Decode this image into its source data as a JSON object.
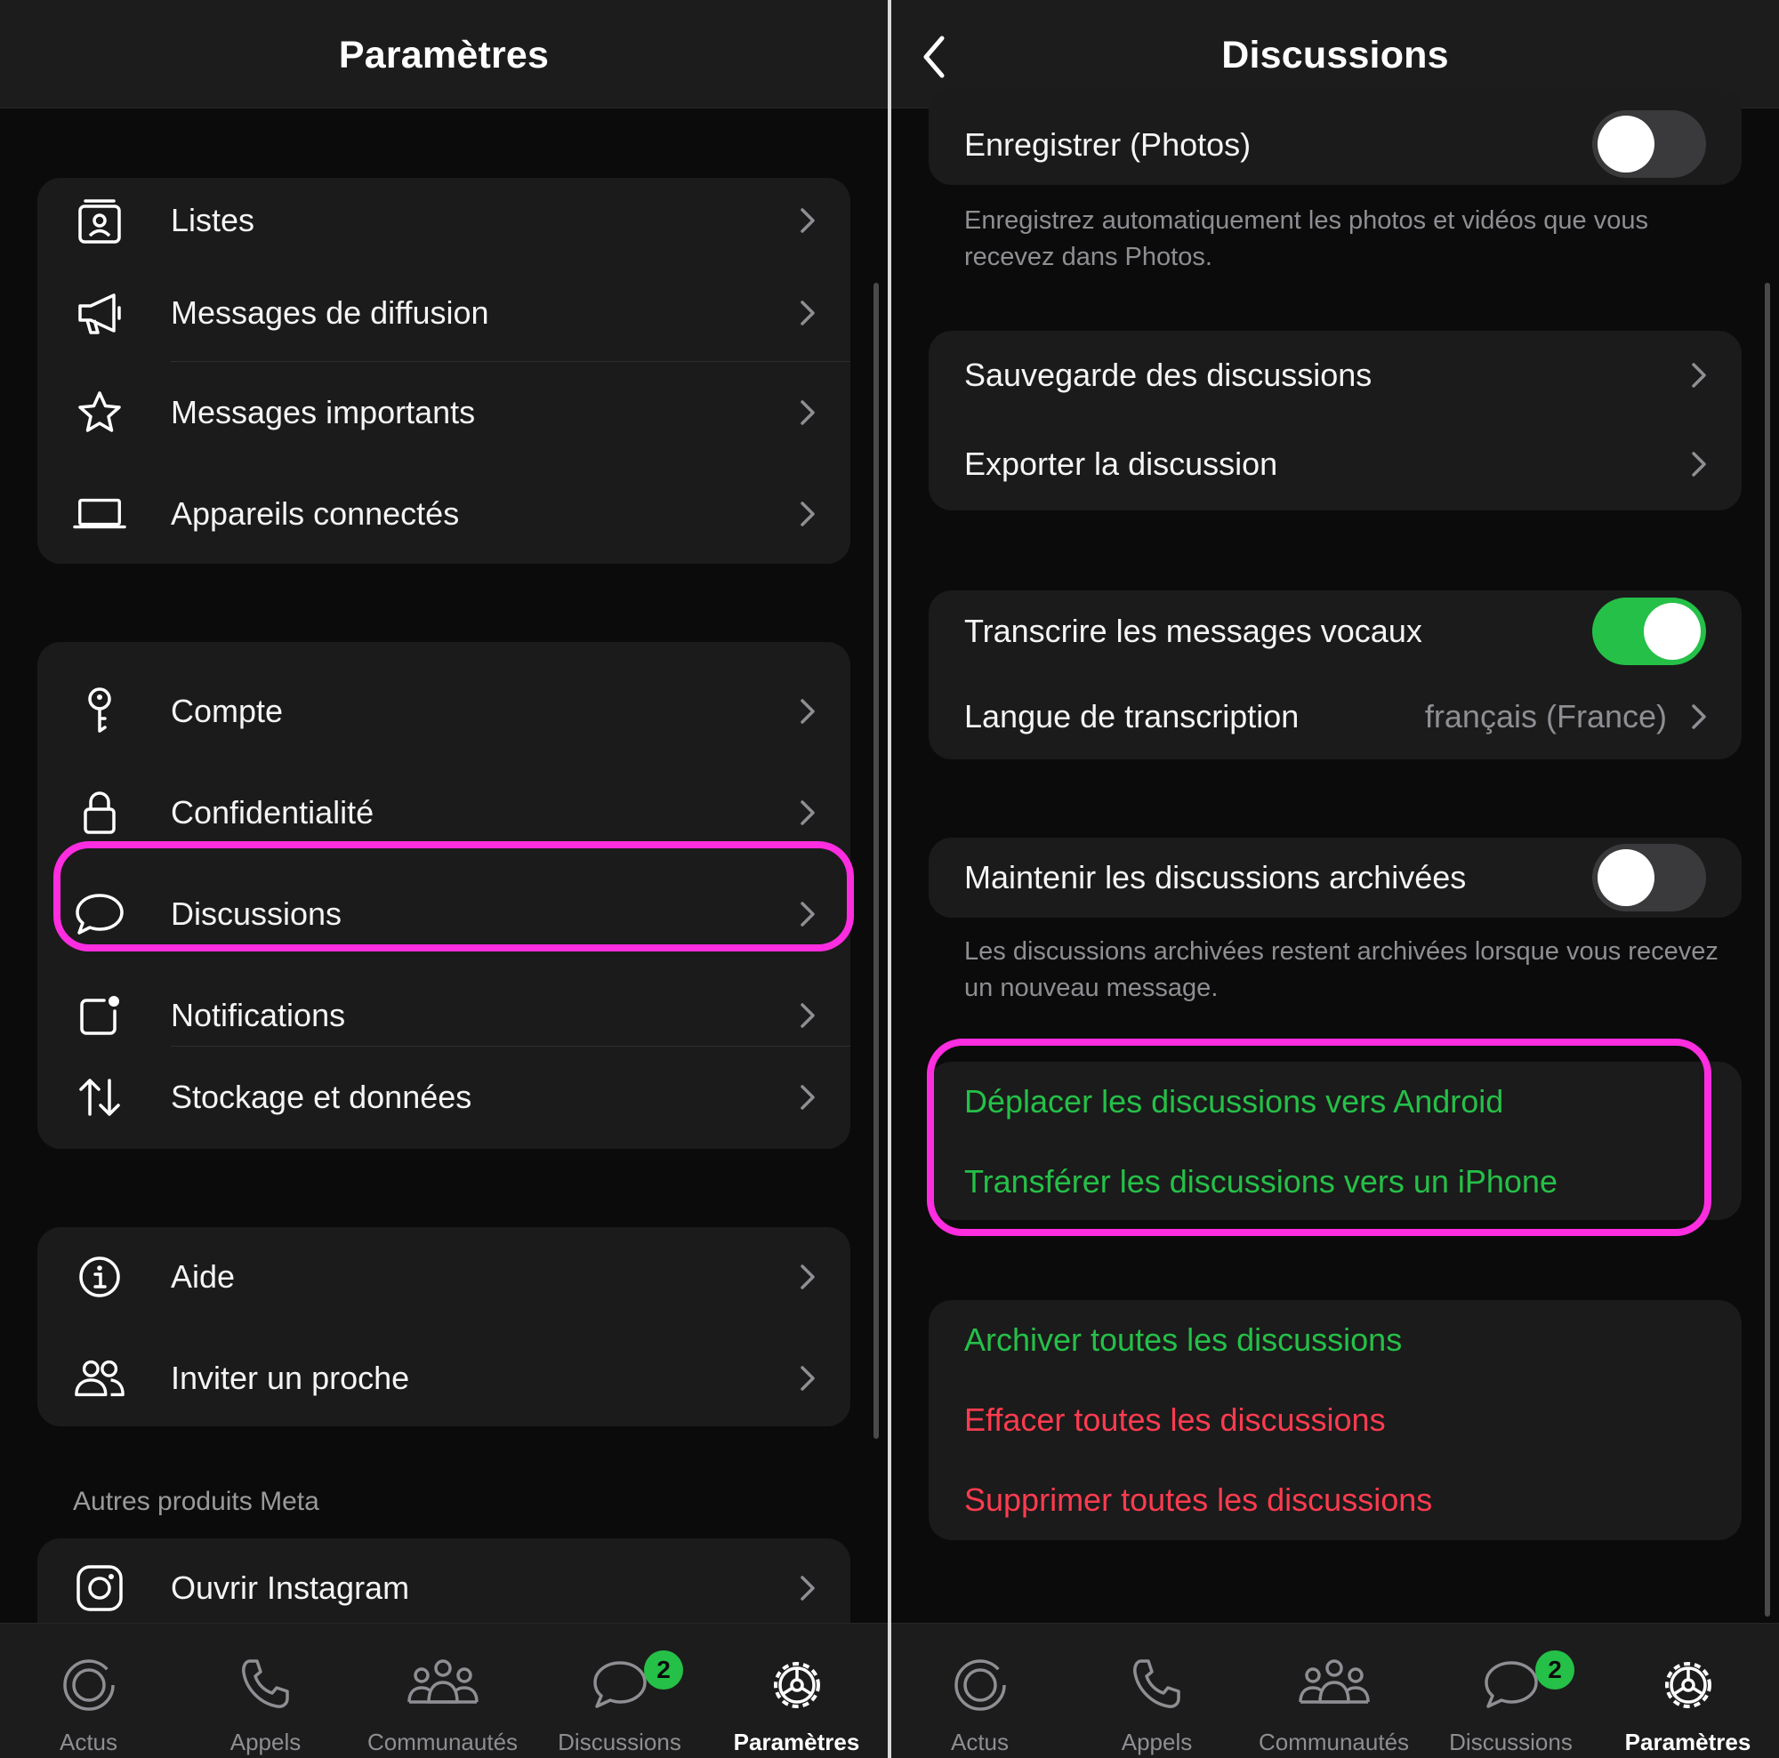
{
  "left": {
    "header": {
      "title": "Paramètres"
    },
    "group1": [
      {
        "label": "Listes",
        "icon": "lists-icon"
      },
      {
        "label": "Messages de diffusion",
        "icon": "megaphone-icon"
      },
      {
        "label": "Messages importants",
        "icon": "star-icon"
      },
      {
        "label": "Appareils connectés",
        "icon": "laptop-icon"
      }
    ],
    "group2": [
      {
        "label": "Compte",
        "icon": "key-icon"
      },
      {
        "label": "Confidentialité",
        "icon": "lock-icon"
      },
      {
        "label": "Discussions",
        "icon": "chat-bubble-icon",
        "highlighted": true
      },
      {
        "label": "Notifications",
        "icon": "notification-icon"
      },
      {
        "label": "Stockage et données",
        "icon": "data-transfer-icon"
      }
    ],
    "group3": [
      {
        "label": "Aide",
        "icon": "info-icon"
      },
      {
        "label": "Inviter un proche",
        "icon": "people-icon"
      }
    ],
    "section_meta": "Autres produits Meta",
    "group4": [
      {
        "label": "Ouvrir Instagram",
        "icon": "instagram-icon"
      }
    ]
  },
  "right": {
    "header": {
      "title": "Discussions"
    },
    "save_photos": {
      "label": "Enregistrer (Photos)",
      "toggle": "off",
      "footnote": "Enregistrez automatiquement les photos et vidéos que vous recevez dans Photos."
    },
    "backup": {
      "label": "Sauvegarde des discussions"
    },
    "export": {
      "label": "Exporter la discussion"
    },
    "transcribe": {
      "label": "Transcrire les messages vocaux",
      "toggle": "on"
    },
    "transcription_lang": {
      "label": "Langue de transcription",
      "value": "français (France)"
    },
    "keep_archived": {
      "label": "Maintenir les discussions archivées",
      "toggle": "off",
      "footnote": "Les discussions archivées restent archivées lorsque vous recevez un nouveau message."
    },
    "move_android": {
      "label": "Déplacer les discussions vers Android"
    },
    "transfer_iphone": {
      "label": "Transférer les discussions vers un iPhone"
    },
    "archive_all": {
      "label": "Archiver toutes les discussions"
    },
    "clear_all": {
      "label": "Effacer toutes les discussions"
    },
    "delete_all": {
      "label": "Supprimer toutes les discussions"
    }
  },
  "tabbar": {
    "tabs": [
      {
        "label": "Actus",
        "icon": "updates-icon"
      },
      {
        "label": "Appels",
        "icon": "phone-icon"
      },
      {
        "label": "Communautés",
        "icon": "communities-icon"
      },
      {
        "label": "Discussions",
        "icon": "chats-icon",
        "badge": "2"
      },
      {
        "label": "Paramètres",
        "icon": "settings-gear-icon",
        "active": true
      }
    ]
  },
  "colors": {
    "accent_green": "#25c048",
    "danger_red": "#ff3b4f",
    "highlight_magenta": "#ff2de0"
  }
}
